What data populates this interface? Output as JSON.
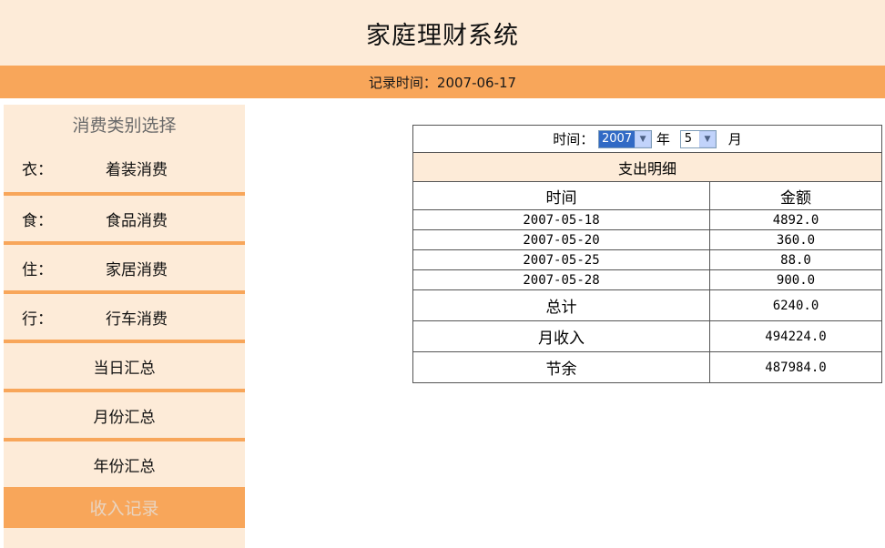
{
  "header": {
    "title": "家庭理财系统"
  },
  "subbar": {
    "record_time": "记录时间：2007-06-17"
  },
  "sidebar": {
    "heading": "消费类别选择",
    "items": [
      {
        "key": "衣：",
        "label": "着装消费"
      },
      {
        "key": "食：",
        "label": "食品消费"
      },
      {
        "key": "住：",
        "label": "家居消费"
      },
      {
        "key": "行：",
        "label": "行车消费"
      }
    ],
    "daily_summary": "当日汇总",
    "monthly_summary": "月份汇总",
    "yearly_summary": "年份汇总",
    "income_record": "收入记录"
  },
  "filter": {
    "time_label": "时间：",
    "year_value": "2007",
    "year_unit": "年",
    "month_value": "5",
    "month_unit": "月"
  },
  "table": {
    "title": "支出明细",
    "columns": [
      "时间",
      "金额"
    ],
    "rows": [
      {
        "date": "2007-05-18",
        "amount": "4892.0"
      },
      {
        "date": "2007-05-20",
        "amount": "360.0"
      },
      {
        "date": "2007-05-25",
        "amount": "88.0"
      },
      {
        "date": "2007-05-28",
        "amount": "900.0"
      }
    ],
    "total_label": "总计",
    "total_value": "6240.0",
    "income_label": "月收入",
    "income_value": "494224.0",
    "balance_label": "节余",
    "balance_value": "487984.0"
  },
  "colors": {
    "accent": "#f8a65a",
    "panel": "#fdebd8"
  }
}
